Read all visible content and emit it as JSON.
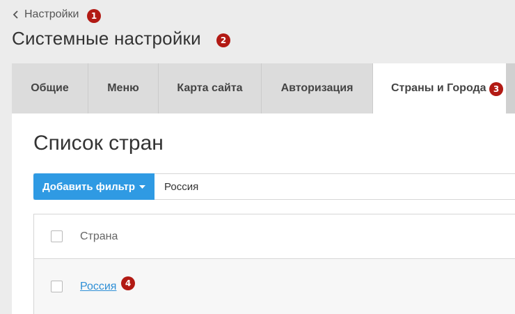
{
  "breadcrumb": {
    "back_label": "Настройки",
    "badge": "1"
  },
  "page": {
    "title": "Системные настройки",
    "badge": "2"
  },
  "tabs": [
    {
      "label": "Общие"
    },
    {
      "label": "Меню"
    },
    {
      "label": "Карта сайта"
    },
    {
      "label": "Авторизация"
    },
    {
      "label": "Страны и Города",
      "active": true,
      "badge": "3"
    }
  ],
  "section": {
    "title": "Список стран"
  },
  "filter": {
    "button_label": "Добавить фильтр",
    "value": "Россия"
  },
  "table": {
    "header": "Страна",
    "rows": [
      {
        "country": "Россия",
        "badge": "4"
      }
    ]
  },
  "colors": {
    "accent": "#2f9ae3",
    "badge": "#b21a14",
    "link": "#2f8fd6"
  }
}
